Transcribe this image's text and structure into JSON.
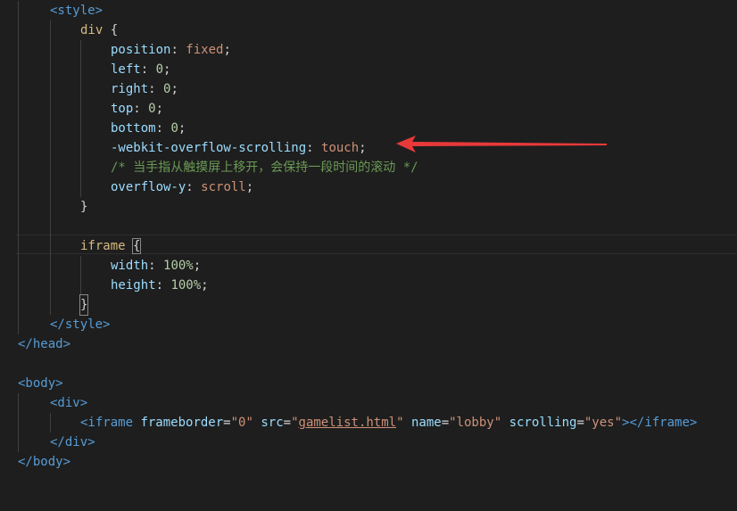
{
  "code": {
    "style_open": "<style>",
    "div_selector": "div",
    "brace_open": " {",
    "position_prop": "position",
    "position_val": "fixed",
    "left_prop": "left",
    "left_val": "0",
    "right_prop": "right",
    "right_val": "0",
    "top_prop": "top",
    "top_val": "0",
    "bottom_prop": "bottom",
    "bottom_val": "0",
    "webkit_prop": "-webkit-overflow-scrolling",
    "webkit_val": "touch",
    "comment": "/* 当手指从触摸屏上移开，会保持一段时间的滚动 */",
    "overflow_prop": "overflow-y",
    "overflow_val": "scroll",
    "brace_close": "}",
    "iframe_selector": "iframe",
    "width_prop": "width",
    "width_val": "100%",
    "height_prop": "height",
    "height_val": "100%",
    "style_close": "</style>",
    "head_close": "</head>",
    "body_open": "<body>",
    "div_open": "<div>",
    "iframe_tag_open": "<iframe",
    "attr_frameborder": "frameborder",
    "val_frameborder": "\"0\"",
    "attr_src": "src",
    "val_src_q1": "\"",
    "val_src": "gamelist.html",
    "val_src_q2": "\"",
    "attr_name": "name",
    "val_name": "\"lobby\"",
    "attr_scrolling": "scrolling",
    "val_scrolling": "\"yes\"",
    "iframe_gt": ">",
    "iframe_close": "</iframe>",
    "div_close": "</div>",
    "body_close": "</body>",
    "colon": ": ",
    "semicolon": ";",
    "eq": "="
  },
  "annotation": {
    "arrow_color": "#e8393a"
  }
}
